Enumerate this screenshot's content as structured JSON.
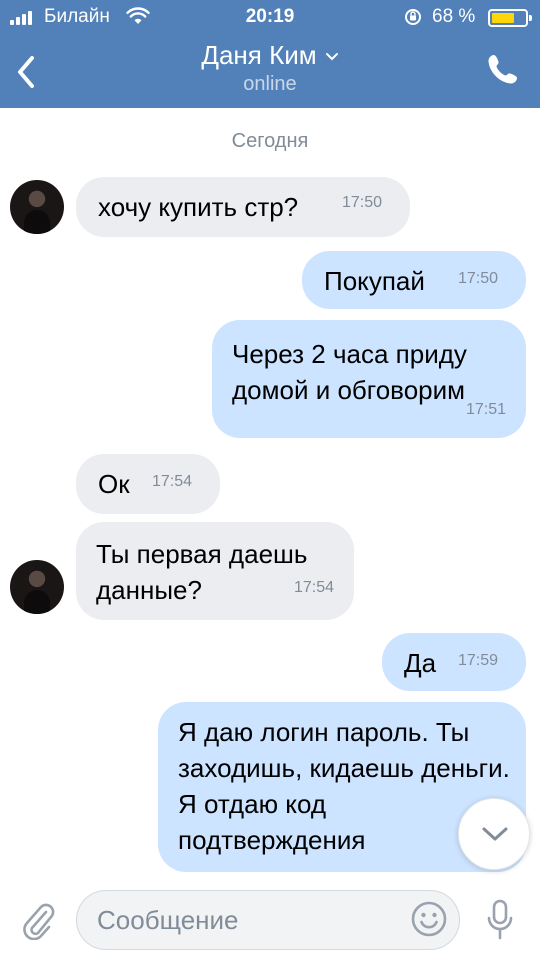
{
  "status_bar": {
    "carrier": "Билайн",
    "time": "20:19",
    "battery_text": "68 %",
    "battery_level": 0.68,
    "battery_color": "#ffd60a"
  },
  "header": {
    "title": "Даня Ким",
    "subtitle": "online",
    "background": "#5181b8",
    "icons": [
      "back-chevron-icon",
      "chevron-down-icon",
      "phone-icon"
    ]
  },
  "chat": {
    "date_label": "Сегодня",
    "messages": [
      {
        "direction": "in",
        "text": "хочу купить стр?",
        "time": "17:50",
        "avatar": true
      },
      {
        "direction": "out",
        "text": "Покупай",
        "time": "17:50"
      },
      {
        "direction": "out",
        "text": "Через 2 часа приду домой и обговорим",
        "time": "17:51"
      },
      {
        "direction": "in",
        "text": "Ок",
        "time": "17:54",
        "avatar": false
      },
      {
        "direction": "in",
        "text": "Ты первая даешь данные?",
        "time": "17:54",
        "avatar": true
      },
      {
        "direction": "out",
        "text": "Да",
        "time": "17:59"
      },
      {
        "direction": "out",
        "text": "Я даю логин пароль. Ты заходишь, кидаешь деньги. Я отдаю код подтверждения",
        "time": ""
      }
    ],
    "colors": {
      "incoming": "#ebedf0",
      "outgoing": "#cce4ff",
      "time": "#818c99"
    }
  },
  "composer": {
    "placeholder": "Сообщение",
    "icons": [
      "paperclip-icon",
      "emoji-icon",
      "microphone-icon",
      "scroll-down-icon"
    ]
  }
}
